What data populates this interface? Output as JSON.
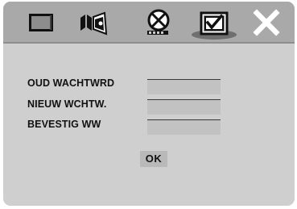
{
  "menu": {
    "icons": [
      {
        "name": "display-icon"
      },
      {
        "name": "audio-icon"
      },
      {
        "name": "disc-icon"
      },
      {
        "name": "preferences-icon",
        "selected": true
      },
      {
        "name": "close-icon"
      }
    ]
  },
  "form": {
    "old_password_label": "OUD WACHTWRD",
    "new_password_label": "NIEUW WCHTW.",
    "confirm_password_label": "BEVESTIG WW",
    "old_password_value": "",
    "new_password_value": "",
    "confirm_password_value": ""
  },
  "ok_label": "OK",
  "colors": {
    "screen_background": "#cfcfcf",
    "top_bar": "#a9a9a9",
    "field_background": "#c2c2c2",
    "button_background": "#b9b9b9",
    "text": "#111111",
    "close_icon": "#ffffff"
  }
}
